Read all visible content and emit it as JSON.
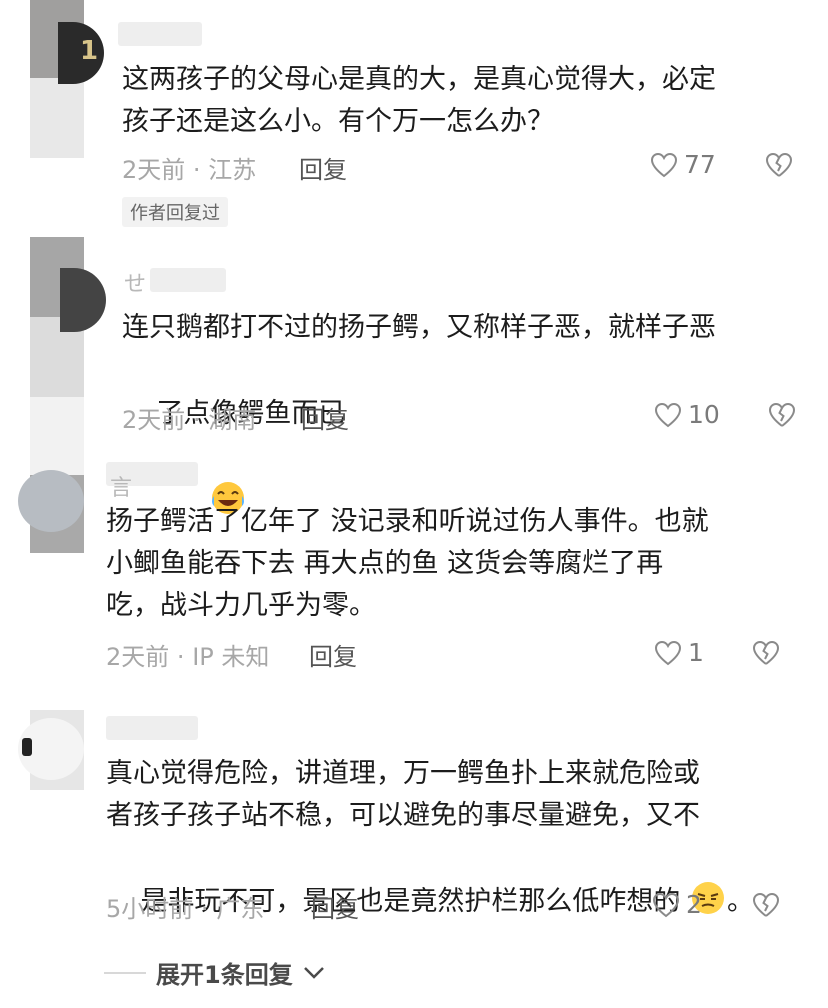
{
  "comments": [
    {
      "lines": [
        "这两孩子的父母心是真的大，是真心觉得大，必定",
        "孩子还是这么小。有个万一怎么办？"
      ],
      "time": "2天前",
      "location": "江苏",
      "reply_label": "回复",
      "likes": "77",
      "badge": "作者回复过"
    },
    {
      "name_char": "せ",
      "lines": [
        "连只鹅都打不过的扬子鳄，又称样子恶，就样子恶",
        "了点像鳄鱼而已"
      ],
      "time": "2天前",
      "location": "湖南",
      "reply_label": "回复",
      "likes": "10"
    },
    {
      "name_char": "言",
      "lines": [
        "扬子鳄活了亿年了 没记录和听说过伤人事件。也就",
        "小鲫鱼能吞下去 再大点的鱼 这货会等腐烂了再",
        "吃，战斗力几乎为零。"
      ],
      "time": "2天前",
      "location": "IP 未知",
      "reply_label": "回复",
      "likes": "1"
    },
    {
      "lines": [
        "真心觉得危险，讲道理，万一鳄鱼扑上来就危险或",
        "者孩子孩子站不稳，可以避免的事尽量避免，又不",
        "是非玩不可，景区也是竟然护栏那么低咋想的 ",
        "。"
      ],
      "time": "5小时前",
      "location": "广东",
      "reply_label": "回复",
      "likes": "2"
    }
  ],
  "expand_label": "展开1条回复",
  "separator": "·"
}
